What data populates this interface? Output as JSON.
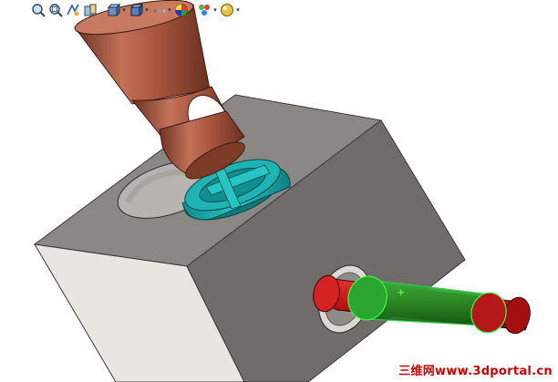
{
  "toolbar": {
    "items": [
      {
        "icon": "zoom-to-fit-icon",
        "has_dropdown": false
      },
      {
        "icon": "zoom-to-area-icon",
        "has_dropdown": false
      },
      {
        "icon": "previous-view-icon",
        "has_dropdown": false
      },
      {
        "icon": "section-view-icon",
        "has_dropdown": false
      },
      {
        "icon": "view-orientation-icon",
        "has_dropdown": true
      },
      {
        "icon": "display-style-icon",
        "has_dropdown": true
      },
      {
        "icon": "hide-show-items-icon",
        "has_dropdown": true
      },
      {
        "icon": "edit-appearance-icon",
        "has_dropdown": true
      },
      {
        "icon": "apply-scene-icon",
        "has_dropdown": true
      },
      {
        "icon": "view-settings-icon",
        "has_dropdown": true
      }
    ]
  },
  "model": {
    "block_colors": {
      "top": "#8a8784",
      "front": "#e9e6e1",
      "right": "#6f6c6a"
    },
    "tool_color": "#b8644a",
    "ring_color": "#1fb3b3",
    "pin_color": "#cc1515",
    "selection_color": "#2ecc40"
  },
  "watermark": {
    "text": "三维网www.3dportal.cn",
    "color": "#d40000"
  }
}
